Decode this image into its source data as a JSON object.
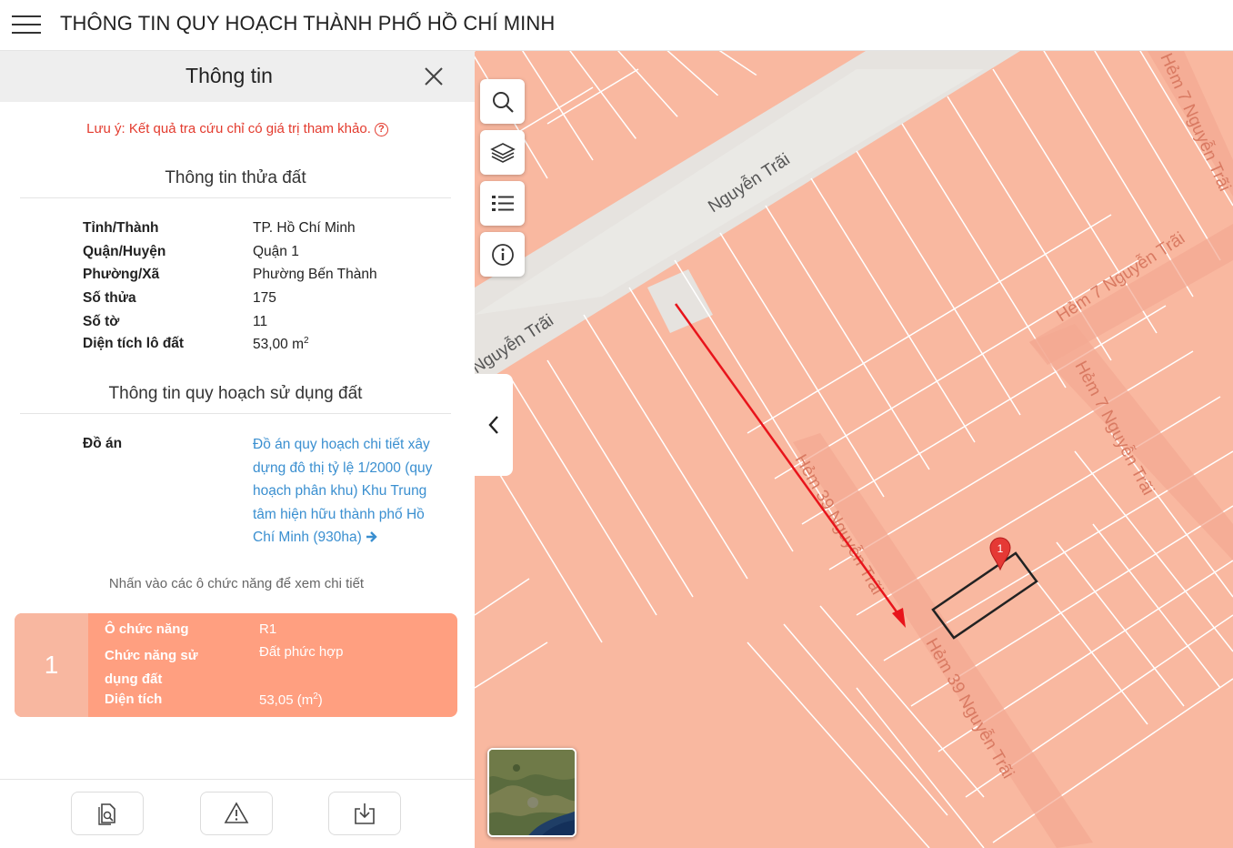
{
  "app": {
    "title": "THÔNG TIN QUY HOẠCH THÀNH PHỐ HỒ CHÍ MINH"
  },
  "panel": {
    "title": "Thông tin",
    "notice": "Lưu ý: Kết quả tra cứu chỉ có giá trị tham khảo.",
    "parcel_section": {
      "title": "Thông tin thửa đất",
      "rows": [
        {
          "label": "Tỉnh/Thành",
          "value": "TP. Hồ Chí Minh"
        },
        {
          "label": "Quận/Huyện",
          "value": "Quận 1"
        },
        {
          "label": "Phường/Xã",
          "value": "Phường Bến Thành"
        },
        {
          "label": "Số thửa",
          "value": "175"
        },
        {
          "label": "Số tờ",
          "value": "11"
        },
        {
          "label": "Diện tích lô đất",
          "value": "53,00 m",
          "unit_sup": "2"
        }
      ]
    },
    "plan_section": {
      "title": "Thông tin quy hoạch sử dụng đất",
      "label": "Đồ án",
      "link_text": "Đồ án quy hoạch chi tiết xây dựng đô thị tỷ lệ 1/2000 (quy hoạch phân khu) Khu Trung tâm hiện hữu thành phố Hồ Chí Minh (930ha)"
    },
    "hint": "Nhấn vào các ô chức năng để xem chi tiết",
    "zone_card": {
      "number": "1",
      "rows": [
        {
          "label": "Ô chức năng",
          "value": "R1"
        },
        {
          "label": "Chức năng sử dụng đất",
          "value": "Đất phức hợp"
        },
        {
          "label": "Diện tích",
          "value": "53,05 (m",
          "unit_sup": "2",
          "value_suffix": ")"
        }
      ],
      "color": "#ff9f80"
    },
    "bottom_actions": [
      "document-search-icon",
      "warning-icon",
      "download-icon"
    ]
  },
  "map": {
    "tools": [
      "search-icon",
      "layers-icon",
      "list-icon",
      "info-icon"
    ],
    "road_labels": [
      "Nguyễn Trãi",
      "Nguyễn Trãi",
      "Hẻm 39 Nguyễn Trãi",
      "Hẻm 39 Nguyễn Trãi",
      "Hẻm 7 Nguyễn Trãi",
      "Hẻm 7 Nguyễn Trãi",
      "Hẻm 7 Nguyễn Trãi"
    ],
    "marker_label": "1",
    "colors": {
      "parcel_fill": "#f9b8a0",
      "parcel_line": "#ffffff",
      "road": "#e6e3df",
      "arrow": "#e8141b",
      "marker": "#e53935"
    }
  }
}
